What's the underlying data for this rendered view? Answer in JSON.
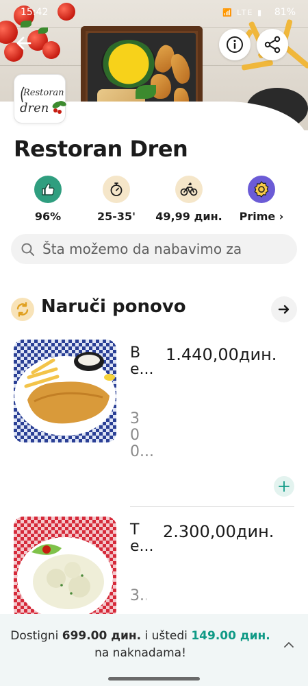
{
  "status_bar": {
    "time": "15:42",
    "battery": "81%"
  },
  "restaurant": {
    "name": "Restoran Dren",
    "logo_text_top": "Restoran",
    "logo_text_bottom": "dren"
  },
  "stats": [
    {
      "icon": "thumbs-up-icon",
      "value": "96%",
      "bg": "#2f9e7f"
    },
    {
      "icon": "stopwatch-icon",
      "value": "25-35'",
      "bg": "#f5e6c9"
    },
    {
      "icon": "bicycle-icon",
      "value": "49,99 дин.",
      "bg": "#f5e6c9"
    },
    {
      "icon": "prime-badge-icon",
      "value": "Prime ›",
      "bg": "#6b5bd6"
    }
  ],
  "search": {
    "placeholder": "Šta možemo da nabavimo za"
  },
  "section": {
    "title": "Naruči ponovo"
  },
  "products": [
    {
      "name": "Be...",
      "desc": "300...",
      "price": "1.440,00дин."
    },
    {
      "name": "Te...",
      "desc": "3...",
      "price": "2.300,00дин."
    }
  ],
  "banner": {
    "prefix": "Dostigni ",
    "amount1": "699.00 дин.",
    "middle": " i uštedi ",
    "amount2": "149.00 дин.",
    "suffix": "na naknadama!"
  },
  "colors": {
    "accent_green": "#109a86",
    "banner_bg": "#f1f6f6"
  }
}
